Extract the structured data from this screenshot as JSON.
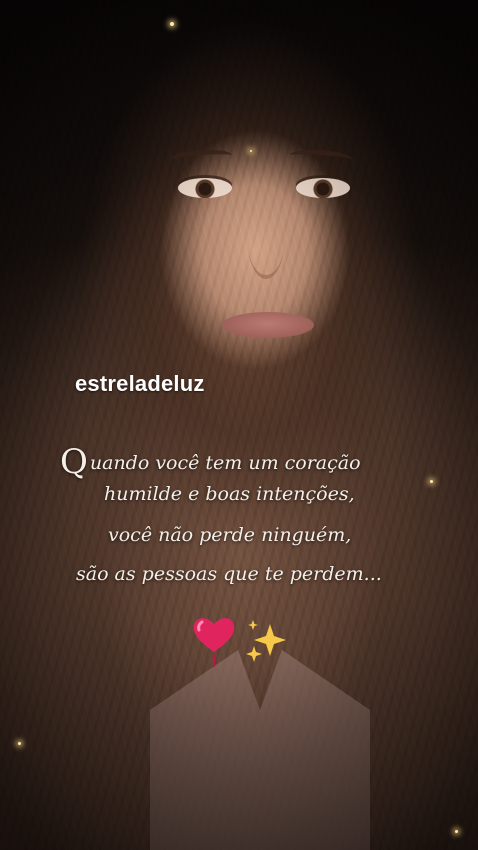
{
  "overlay": {
    "username": "estreladeluz"
  },
  "quote": {
    "dropcap": "Q",
    "line1": "uando você tem um coração",
    "line2": "humilde e boas intenções,",
    "line3": "você não perde ninguém,",
    "line4": "são as pessoas que te perdem..."
  },
  "icons": [
    "heart-icon",
    "sparkles-icon"
  ],
  "colors": {
    "text": "#f4efe9",
    "heart": "#e0245e",
    "sparkle": "#f7c948"
  }
}
